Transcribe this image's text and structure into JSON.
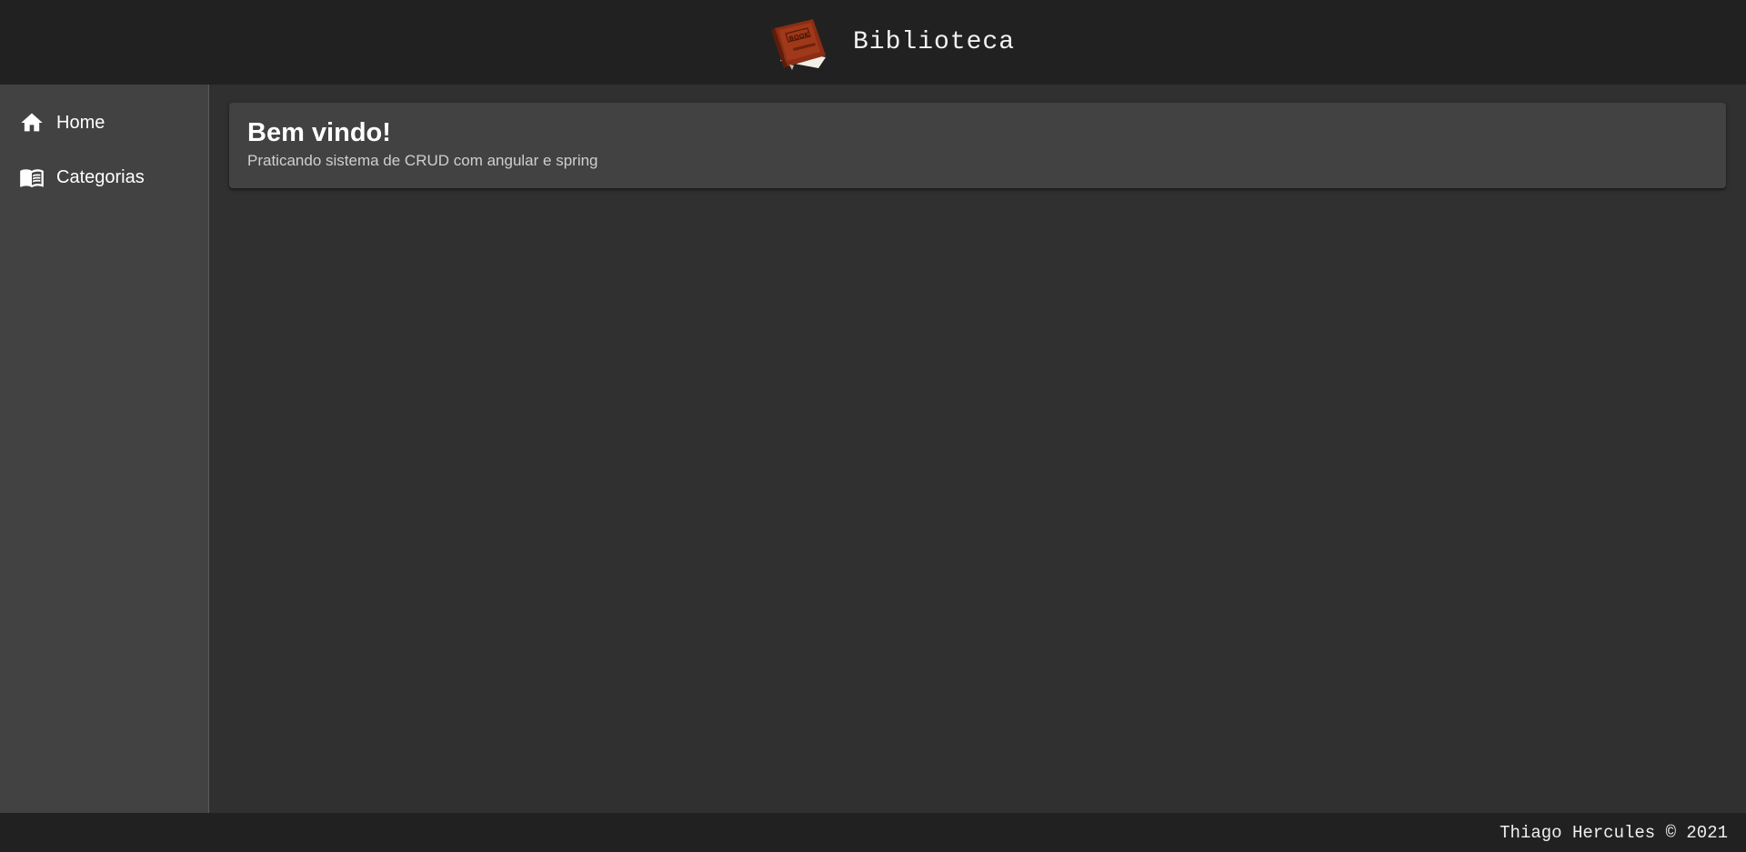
{
  "header": {
    "title": "Biblioteca",
    "logo_icon": "book-icon",
    "logo_text": "BOOK",
    "brand_color": "#8b2d14"
  },
  "sidebar": {
    "items": [
      {
        "label": "Home",
        "icon": "home-icon"
      },
      {
        "label": "Categorias",
        "icon": "menu-book-icon"
      }
    ]
  },
  "main": {
    "card": {
      "title": "Bem vindo!",
      "subtitle": "Praticando sistema de CRUD com angular e spring"
    }
  },
  "footer": {
    "text": "Thiago Hercules © 2021"
  },
  "colors": {
    "toolbar": "#212121",
    "sidebar": "#424242",
    "content": "#303030",
    "card": "#424242"
  }
}
